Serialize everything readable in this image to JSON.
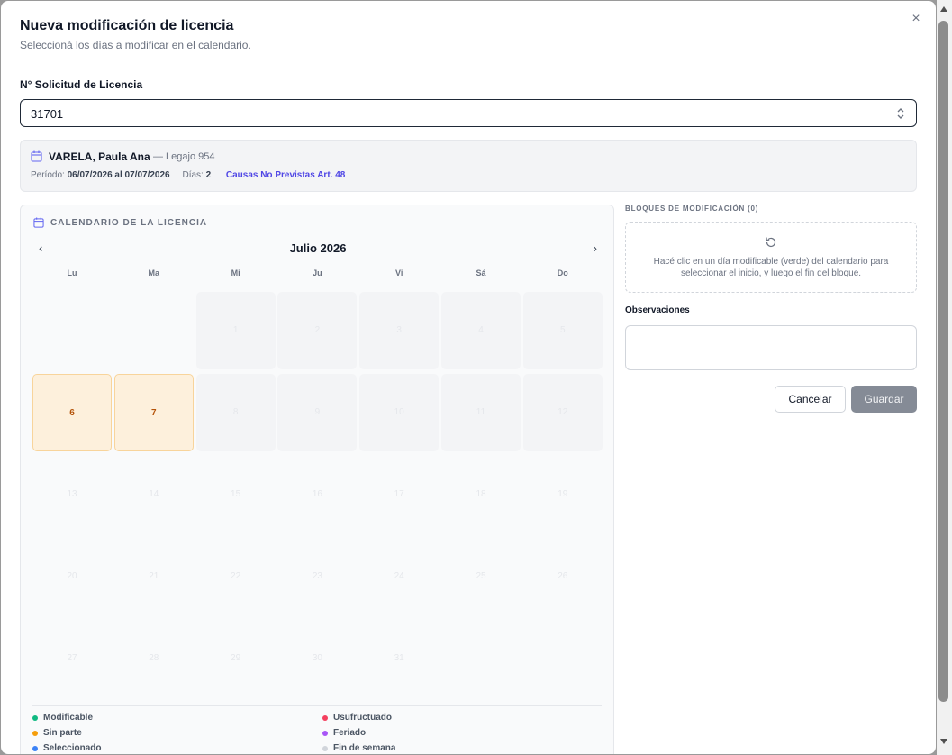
{
  "modal": {
    "title": "Nueva modificación de licencia",
    "subtitle": "Seleccioná los días a modificar en el calendario.",
    "close": "×"
  },
  "request": {
    "label": "N° Solicitud de Licencia",
    "value": "31701"
  },
  "employee": {
    "name": "VARELA, Paula Ana",
    "legajo": "— Legajo 954",
    "period_label": "Período:",
    "period_value": "06/07/2026 al 07/07/2026",
    "days_label": "Días:",
    "days_value": "2",
    "cause": "Causas No Previstas Art. 48"
  },
  "calendar": {
    "heading": "CALENDARIO DE LA LICENCIA",
    "month": "Julio 2026",
    "prev": "‹",
    "next": "›",
    "weekdays": [
      "Lu",
      "Ma",
      "Mi",
      "Ju",
      "Vi",
      "Sá",
      "Do"
    ],
    "days": [
      {
        "n": "",
        "s": "empty"
      },
      {
        "n": "",
        "s": "empty"
      },
      {
        "n": "1",
        "s": "off"
      },
      {
        "n": "2",
        "s": "off"
      },
      {
        "n": "3",
        "s": "off"
      },
      {
        "n": "4",
        "s": "off"
      },
      {
        "n": "5",
        "s": "off"
      },
      {
        "n": "6",
        "s": "sel"
      },
      {
        "n": "7",
        "s": "sel"
      },
      {
        "n": "8",
        "s": "off"
      },
      {
        "n": "9",
        "s": "off"
      },
      {
        "n": "10",
        "s": "off"
      },
      {
        "n": "11",
        "s": "off"
      },
      {
        "n": "12",
        "s": "off"
      },
      {
        "n": "13",
        "s": "plain"
      },
      {
        "n": "14",
        "s": "plain"
      },
      {
        "n": "15",
        "s": "plain"
      },
      {
        "n": "16",
        "s": "plain"
      },
      {
        "n": "17",
        "s": "plain"
      },
      {
        "n": "18",
        "s": "plain"
      },
      {
        "n": "19",
        "s": "plain"
      },
      {
        "n": "20",
        "s": "plain"
      },
      {
        "n": "21",
        "s": "plain"
      },
      {
        "n": "22",
        "s": "plain"
      },
      {
        "n": "23",
        "s": "plain"
      },
      {
        "n": "24",
        "s": "plain"
      },
      {
        "n": "25",
        "s": "plain"
      },
      {
        "n": "26",
        "s": "plain"
      },
      {
        "n": "27",
        "s": "plain"
      },
      {
        "n": "28",
        "s": "plain"
      },
      {
        "n": "29",
        "s": "plain"
      },
      {
        "n": "30",
        "s": "plain"
      },
      {
        "n": "31",
        "s": "plain"
      }
    ],
    "legend": [
      {
        "label": "Modificable",
        "color": "#10b981"
      },
      {
        "label": "Sin parte",
        "color": "#f59e0b"
      },
      {
        "label": "Seleccionado",
        "color": "#3b82f6"
      },
      {
        "label": "Usufructuado",
        "color": "#f43f5e"
      },
      {
        "label": "Feriado",
        "color": "#a855f7"
      },
      {
        "label": "Fin de semana",
        "color": "#d1d5db"
      }
    ]
  },
  "blocks": {
    "title": "BLOQUES DE MODIFICACIÓN (0)",
    "hint": "Hacé clic en un día modificable (verde) del calendario para seleccionar el inicio, y luego el fin del bloque."
  },
  "observations": {
    "label": "Observaciones",
    "value": ""
  },
  "actions": {
    "cancel": "Cancelar",
    "save": "Guardar"
  }
}
